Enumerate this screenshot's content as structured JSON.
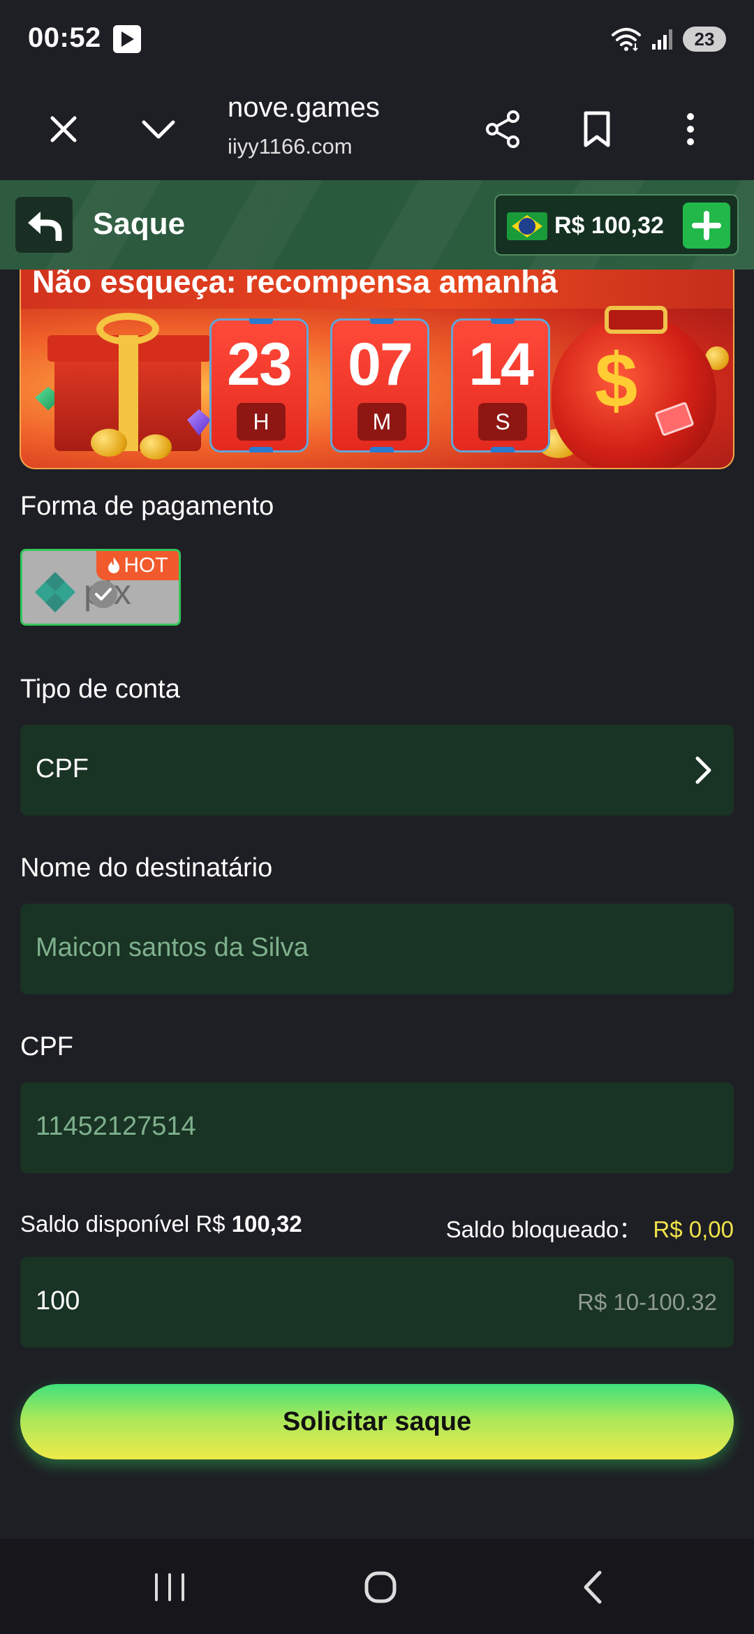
{
  "status_bar": {
    "time": "00:52",
    "battery": "23",
    "icons": [
      "play-store-icon",
      "wifi-icon",
      "signal-icon",
      "battery-icon"
    ]
  },
  "browser": {
    "title": "nove.games",
    "url": "iiyy1166.com",
    "icons": [
      "close-icon",
      "chevron-down-icon",
      "share-icon",
      "bookmark-icon",
      "more-vert-icon"
    ]
  },
  "header": {
    "title": "Saque",
    "balance": "R$ 100,32",
    "flag": "brazil-flag-icon"
  },
  "banner": {
    "headline": "Não esqueça: recompensa amanhã",
    "timer": [
      {
        "value": "23",
        "unit": "H"
      },
      {
        "value": "07",
        "unit": "M"
      },
      {
        "value": "14",
        "unit": "S"
      }
    ]
  },
  "payment": {
    "label": "Forma de pagamento",
    "method": "pix",
    "hot_badge": "HOT"
  },
  "account_type": {
    "label": "Tipo de conta",
    "value": "CPF"
  },
  "recipient": {
    "label": "Nome do destinatário",
    "value": "Maicon santos da Silva"
  },
  "cpf": {
    "label": "CPF",
    "value": "11452127514"
  },
  "saldo": {
    "available_label": "Saldo disponível R$",
    "available_value": "100,32",
    "blocked_label": "Saldo bloqueado：",
    "blocked_value": "R$ 0,00"
  },
  "amount": {
    "value": "100",
    "range": "R$ 10-100.32"
  },
  "submit": {
    "label": "Solicitar saque"
  },
  "colors": {
    "background": "#1e1f24",
    "field": "#193324",
    "header": "#2a5a3d",
    "accent_green": "#22b84a",
    "accent_yellow": "#f2e34a"
  }
}
